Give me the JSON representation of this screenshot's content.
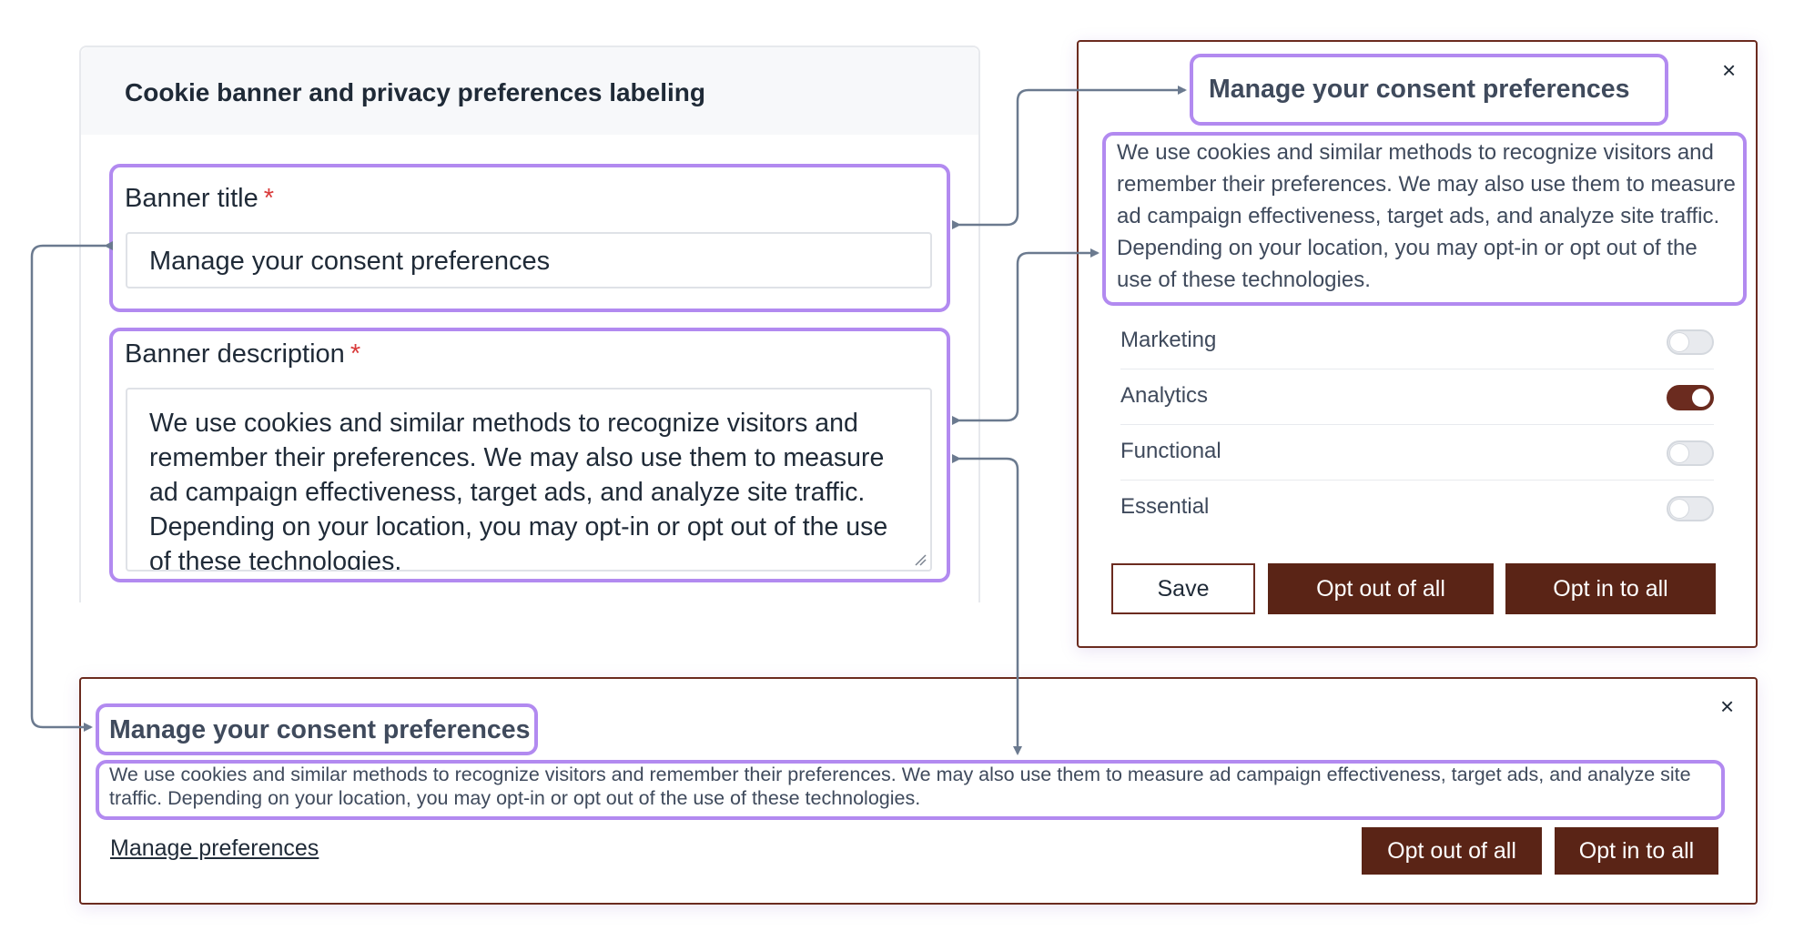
{
  "settings": {
    "title": "Cookie banner and privacy preferences labeling",
    "banner_title_label": "Banner title",
    "banner_description_label": "Banner description",
    "required_mark": "*",
    "banner_title_value": "Manage your consent preferences",
    "banner_description_value": "We use cookies and similar methods to recognize visitors and remember their preferences. We may also use them to measure ad campaign effectiveness, target ads, and analyze site traffic. Depending on your location, you may opt-in or opt out of the use of these technologies."
  },
  "preferences_modal": {
    "close": "×",
    "title": "Manage your consent preferences",
    "description": "We use cookies and similar methods to recognize visitors and remember their preferences. We may also use them to measure ad campaign effectiveness, target ads, and analyze site traffic. Depending on your location, you may opt-in or opt out of the use of these technologies.",
    "toggles": [
      {
        "label": "Marketing",
        "on": false
      },
      {
        "label": "Analytics",
        "on": true
      },
      {
        "label": "Functional",
        "on": false
      },
      {
        "label": "Essential",
        "on": false
      }
    ],
    "save_label": "Save",
    "opt_out_label": "Opt out of all",
    "opt_in_label": "Opt in to all"
  },
  "banner": {
    "close": "×",
    "title": "Manage your consent preferences",
    "description": "We use cookies and similar methods to recognize visitors and remember their preferences. We may also use them to measure ad campaign effectiveness, target ads, and analyze site traffic. Depending on your location, you may opt-in or opt out of the use of these technologies.",
    "manage_link": "Manage preferences",
    "opt_out_label": "Opt out of all",
    "opt_in_label": "Opt in to all"
  },
  "colors": {
    "brand": "#5a2416",
    "highlight": "#b28af0",
    "connector": "#6b7a8f",
    "required": "#d93b3b"
  }
}
